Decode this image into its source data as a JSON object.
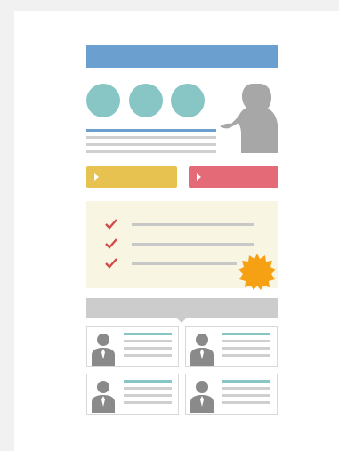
{
  "page": {
    "title": ""
  },
  "colors": {
    "background": "#f1f1f1",
    "card": "#ffffff",
    "header": "#6b9fd0",
    "teal": "#88c6c6",
    "text_line": "#cfcfcf",
    "blue_line": "#6b9fd0",
    "yellow_button": "#e8c251",
    "red_button": "#e56a78",
    "check_panel": "#f8f6e2",
    "check": "#d24b4b",
    "badge": "#f6a114",
    "grey": "#cccccc",
    "avatar": "#8a8a8a"
  },
  "icons": {
    "circles": [
      "circle-icon",
      "circle-icon",
      "circle-icon"
    ],
    "presenter": "presenter-silhouette-icon",
    "play": "play-arrow-icon",
    "check": "check-icon",
    "badge": "starburst-badge-icon",
    "avatar": "person-avatar-icon"
  }
}
